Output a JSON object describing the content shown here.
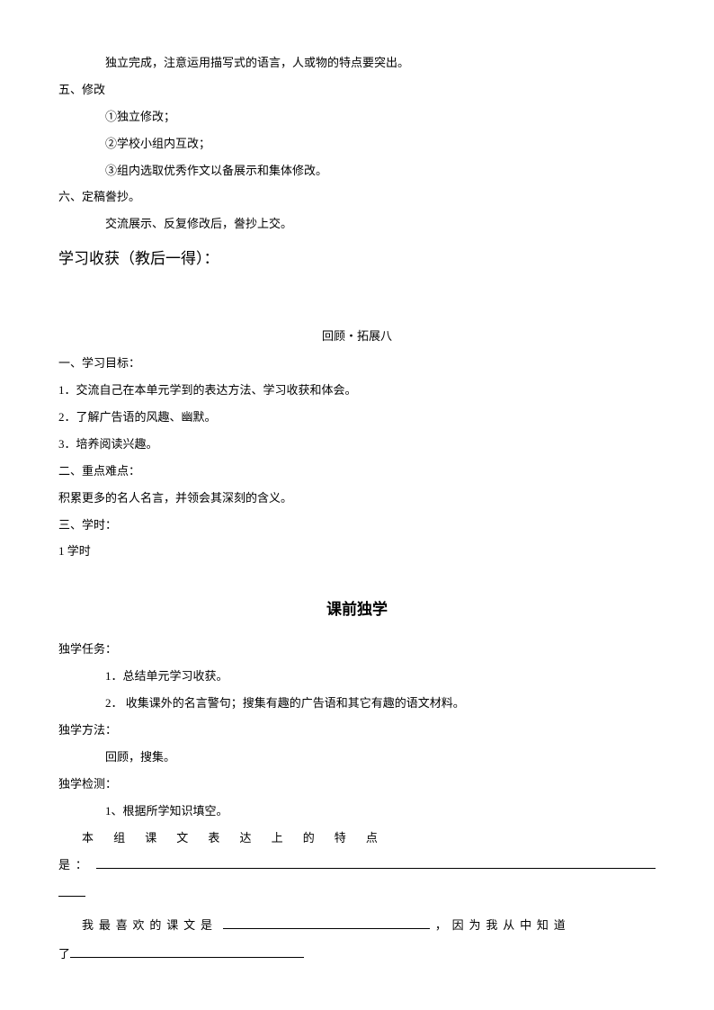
{
  "top": {
    "line1": "独立完成，注意运用描写式的语言，人或物的特点要突出。",
    "section5": "五、修改",
    "rev1": "①独立修改；",
    "rev2": "②学校小组内互改；",
    "rev3": "③组内选取优秀作文以备展示和集体修改。",
    "section6": "六、定稿誊抄。",
    "line6": "交流展示、反复修改后，誊抄上交。",
    "harvest": "学习收获（教后一得）："
  },
  "middle": {
    "title": "回顾・拓展八",
    "objHeading": "一、学习目标：",
    "obj1": "1．交流自己在本单元学到的表达方法、学习收获和体会。",
    "obj2": "2．了解广告语的风趣、幽默。",
    "obj3": "3．培养阅读兴趣。",
    "diffHeading": "二、重点难点：",
    "diffLine": "积累更多的名人名言，并领会其深刻的含义。",
    "hoursHeading": "三、学时：",
    "hours": "1 学时"
  },
  "bottom": {
    "title": "课前独学",
    "task": "独学任务：",
    "task1": "1．总结单元学习收获。",
    "task2": "2． 收集课外的名言警句；搜集有趣的广告语和其它有趣的语文材料。",
    "method": "独学方法：",
    "methodLine": "回顾，搜集。",
    "check": "独学检测：",
    "check1": "1、根据所学知识填空。",
    "fill1_label": "本组课文表达上的特点",
    "fill1_prefix": "是：",
    "fill2_prefix": "我最喜欢的课文是",
    "fill2_middle": "，因为我从中知道",
    "fill2_end": "了"
  }
}
